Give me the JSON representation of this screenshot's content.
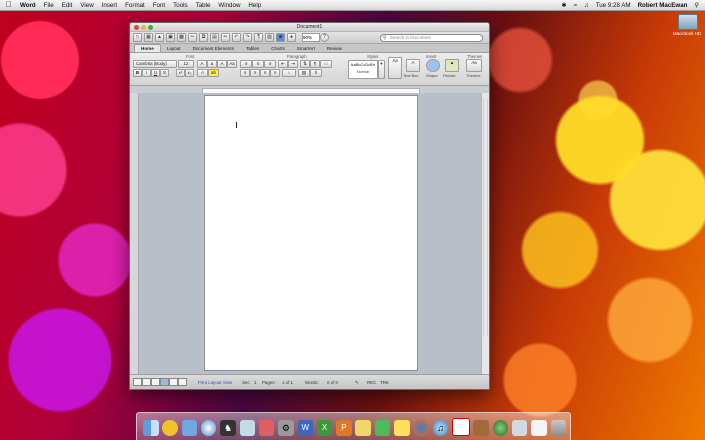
{
  "menubar": {
    "app": "Word",
    "items": [
      "File",
      "Edit",
      "View",
      "Insert",
      "Format",
      "Font",
      "Tools",
      "Table",
      "Window",
      "Help"
    ],
    "clock": "Tue 9:28 AM",
    "user": "Robert MacEwan"
  },
  "desktop": {
    "drive_label": "Macintosh HD"
  },
  "window": {
    "title": "Document1",
    "zoom": "90%",
    "search_placeholder": "Search in Document",
    "tabs": [
      "Home",
      "Layout",
      "Document Elements",
      "Tables",
      "Charts",
      "SmartArt",
      "Review"
    ],
    "ribbon": {
      "groups": [
        "Font",
        "Paragraph",
        "Styles",
        "Insert",
        "Themes"
      ],
      "font_name": "Cambria (Body)",
      "font_size": "12",
      "style_preview": "AaBbCcDdEe",
      "style_name": "Normal",
      "insert_buttons": [
        "Text Box",
        "Shape",
        "Picture"
      ],
      "themes_button": "Themes"
    },
    "status": {
      "view": "Print Layout View",
      "sec": "Sec",
      "sec_value": "1",
      "pages": "Pages:",
      "pages_value": "1 of 1",
      "words": "Words:",
      "words_value": "0 of 0",
      "trk": "TRK",
      "rec": "REC"
    }
  },
  "dock": {
    "icons": [
      "finder-icon",
      "adium-icon",
      "mail-icon",
      "safari-icon",
      "chess-icon",
      "preview-icon",
      "iphoto-icon",
      "system-preferences-icon",
      "word-icon",
      "excel-icon",
      "powerpoint-icon",
      "entourage-icon",
      "messenger-icon",
      "stickies-icon",
      "firefox-icon",
      "itunes-icon",
      "ical-icon",
      "address-book-icon",
      "time-machine-icon",
      "documents-icon",
      "downloads-icon",
      "trash-icon"
    ]
  },
  "colors": {
    "accent": "#3a6fd8",
    "desktop_red": "#c0001c",
    "desktop_yellow": "#ffd22e"
  }
}
